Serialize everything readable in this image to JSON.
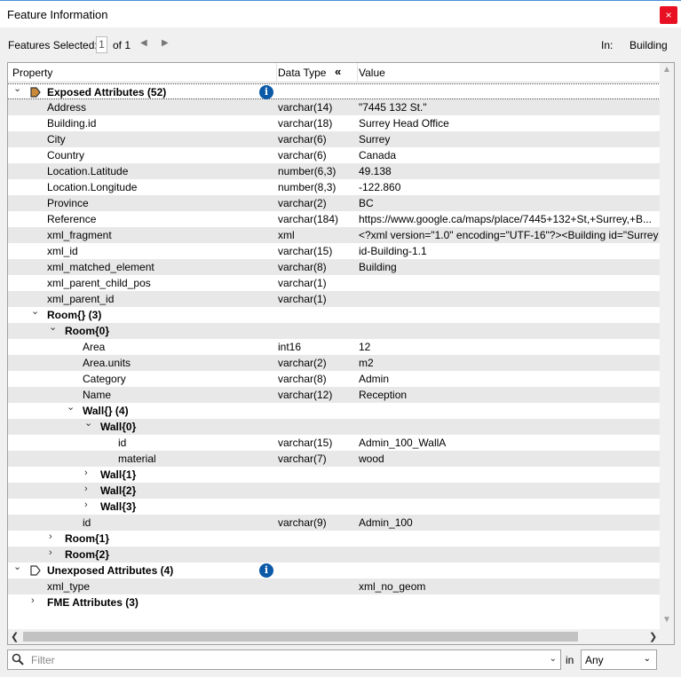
{
  "window": {
    "title": "Feature Information",
    "close_glyph": "×"
  },
  "selection": {
    "label": "Features Selected:",
    "current": "1",
    "of_text": "of 1",
    "prev_glyph": "◀",
    "next_glyph": "▶",
    "in_label": "In:",
    "in_value": "Building"
  },
  "columns": {
    "property": "Property",
    "data_type": "Data Type",
    "collapse_glyph": "«",
    "value": "Value"
  },
  "rows": [
    {
      "name": "Exposed Attributes (52)",
      "type": "",
      "value": "",
      "indent": 0,
      "bold": true,
      "expander": "expanded",
      "icon": "tag-filled-icon",
      "info": true,
      "selected": true
    },
    {
      "name": "Address",
      "type": "varchar(14)",
      "value": "\"7445 132 St.\"",
      "indent": 1
    },
    {
      "name": "Building.id",
      "type": "varchar(18)",
      "value": "Surrey Head Office",
      "indent": 1
    },
    {
      "name": "City",
      "type": "varchar(6)",
      "value": "Surrey",
      "indent": 1
    },
    {
      "name": "Country",
      "type": "varchar(6)",
      "value": "Canada",
      "indent": 1
    },
    {
      "name": "Location.Latitude",
      "type": "number(6,3)",
      "value": "49.138",
      "indent": 1
    },
    {
      "name": "Location.Longitude",
      "type": "number(8,3)",
      "value": "-122.860",
      "indent": 1
    },
    {
      "name": "Province",
      "type": "varchar(2)",
      "value": "BC",
      "indent": 1
    },
    {
      "name": "Reference",
      "type": "varchar(184)",
      "value": "https://www.google.ca/maps/place/7445+132+St,+Surrey,+B...",
      "indent": 1
    },
    {
      "name": "xml_fragment",
      "type": "xml",
      "value": "<?xml version=\"1.0\" encoding=\"UTF-16\"?><Building id=\"Surrey",
      "indent": 1
    },
    {
      "name": "xml_id",
      "type": "varchar(15)",
      "value": "id-Building-1.1",
      "indent": 1
    },
    {
      "name": "xml_matched_element",
      "type": "varchar(8)",
      "value": "Building",
      "indent": 1
    },
    {
      "name": "xml_parent_child_pos",
      "type": "varchar(1)",
      "value": "",
      "indent": 1
    },
    {
      "name": "xml_parent_id",
      "type": "varchar(1)",
      "value": "",
      "indent": 1
    },
    {
      "name": "Room{} (3)",
      "type": "",
      "value": "",
      "indent": 1,
      "bold": true,
      "expander": "expanded"
    },
    {
      "name": "Room{0}",
      "type": "",
      "value": "",
      "indent": 2,
      "bold": true,
      "expander": "expanded"
    },
    {
      "name": "Area",
      "type": "int16",
      "value": "12",
      "indent": 3
    },
    {
      "name": "Area.units",
      "type": "varchar(2)",
      "value": "m2",
      "indent": 3
    },
    {
      "name": "Category",
      "type": "varchar(8)",
      "value": "Admin",
      "indent": 3
    },
    {
      "name": "Name",
      "type": "varchar(12)",
      "value": "Reception",
      "indent": 3
    },
    {
      "name": "Wall{} (4)",
      "type": "",
      "value": "",
      "indent": 3,
      "bold": true,
      "expander": "expanded"
    },
    {
      "name": "Wall{0}",
      "type": "",
      "value": "",
      "indent": 4,
      "bold": true,
      "expander": "expanded"
    },
    {
      "name": "id",
      "type": "varchar(15)",
      "value": "Admin_100_WallA",
      "indent": 5
    },
    {
      "name": "material",
      "type": "varchar(7)",
      "value": "wood",
      "indent": 5
    },
    {
      "name": "Wall{1}",
      "type": "",
      "value": "",
      "indent": 4,
      "bold": true,
      "expander": "collapsed"
    },
    {
      "name": "Wall{2}",
      "type": "",
      "value": "",
      "indent": 4,
      "bold": true,
      "expander": "collapsed"
    },
    {
      "name": "Wall{3}",
      "type": "",
      "value": "",
      "indent": 4,
      "bold": true,
      "expander": "collapsed"
    },
    {
      "name": "id",
      "type": "varchar(9)",
      "value": "Admin_100",
      "indent": 3
    },
    {
      "name": "Room{1}",
      "type": "",
      "value": "",
      "indent": 2,
      "bold": true,
      "expander": "collapsed"
    },
    {
      "name": "Room{2}",
      "type": "",
      "value": "",
      "indent": 2,
      "bold": true,
      "expander": "collapsed"
    },
    {
      "name": "Unexposed Attributes (4)",
      "type": "",
      "value": "",
      "indent": 0,
      "bold": true,
      "expander": "expanded",
      "icon": "tag-outline-icon",
      "info": true
    },
    {
      "name": "xml_type",
      "type": "",
      "value": "xml_no_geom",
      "indent": 1
    },
    {
      "name": "FME Attributes (3)",
      "type": "",
      "value": "",
      "indent": 1,
      "bold": true,
      "expander": "collapsed"
    }
  ],
  "glyphs": {
    "expanded": "⌄",
    "collapsed": "›",
    "info": "i",
    "scroll_up": "▲",
    "scroll_down": "▼",
    "scroll_left": "❮",
    "scroll_right": "❯",
    "dropdown": "⌄"
  },
  "filter": {
    "placeholder": "Filter",
    "in_label": "in",
    "scope_value": "Any"
  },
  "colors": {
    "close_button": "#e81123",
    "info_icon": "#0b5aa8",
    "tag_icon_fill": "#c8893a",
    "alt_row": "#e8e8e8"
  }
}
